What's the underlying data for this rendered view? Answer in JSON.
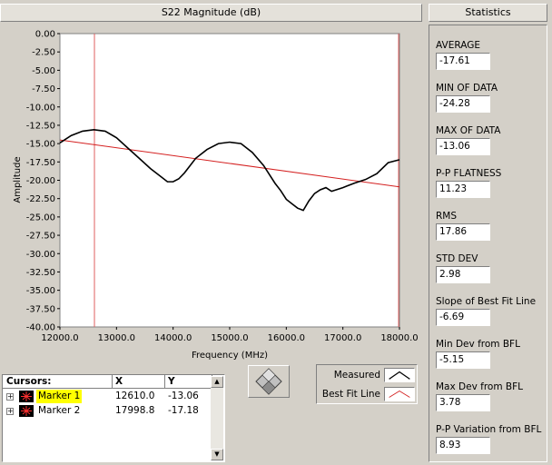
{
  "graph": {
    "title": "S22 Magnitude (dB)"
  },
  "stats": {
    "title": "Statistics",
    "items": [
      {
        "label": "AVERAGE",
        "value": "-17.61"
      },
      {
        "label": "MIN OF DATA",
        "value": "-24.28"
      },
      {
        "label": "MAX OF DATA",
        "value": "-13.06"
      },
      {
        "label": "P-P FLATNESS",
        "value": "11.23"
      },
      {
        "label": "RMS",
        "value": "17.86"
      },
      {
        "label": "STD DEV",
        "value": "2.98"
      },
      {
        "label": "Slope of Best Fit Line",
        "value": "-6.69"
      },
      {
        "label": "Min Dev from BFL",
        "value": "-5.15"
      },
      {
        "label": "Max Dev from BFL",
        "value": "3.78"
      },
      {
        "label": "P-P Variation from BFL",
        "value": "8.93"
      }
    ]
  },
  "cursors": {
    "header": "Cursors:",
    "col_x": "X",
    "col_y": "Y",
    "rows": [
      {
        "name": "Marker 1",
        "x": "12610.0",
        "y": "-13.06"
      },
      {
        "name": "Marker 2",
        "x": "17998.8",
        "y": "-17.18"
      }
    ]
  },
  "legend": {
    "measured": "Measured",
    "bestfit": "Best Fit Line"
  },
  "colors": {
    "measured": "#000000",
    "bestfit": "#d42020",
    "cursor_line": "#e06060",
    "highlight": "#ffff00"
  },
  "chart_data": {
    "type": "line",
    "title": "S22 Magnitude (dB)",
    "xlabel": "Frequency (MHz)",
    "ylabel": "Amplitude",
    "xlim": [
      12000,
      18000
    ],
    "ylim": [
      -40,
      0
    ],
    "x_ticks": [
      "12000.0",
      "13000.0",
      "14000.0",
      "15000.0",
      "16000.0",
      "17000.0",
      "18000.0"
    ],
    "y_ticks": [
      "0.00",
      "-2.50",
      "-5.00",
      "-7.50",
      "-10.00",
      "-12.50",
      "-15.00",
      "-17.50",
      "-20.00",
      "-22.50",
      "-25.00",
      "-27.50",
      "-30.00",
      "-32.50",
      "-35.00",
      "-37.50",
      "-40.00"
    ],
    "grid": false,
    "series": [
      {
        "name": "Measured",
        "x": [
          12000,
          12200,
          12400,
          12600,
          12800,
          13000,
          13200,
          13400,
          13600,
          13800,
          13900,
          14000,
          14100,
          14200,
          14300,
          14400,
          14600,
          14800,
          15000,
          15200,
          15400,
          15600,
          15800,
          15900,
          16000,
          16100,
          16200,
          16300,
          16400,
          16500,
          16600,
          16700,
          16800,
          17000,
          17200,
          17400,
          17600,
          17800,
          18000
        ],
        "y": [
          -14.9,
          -13.9,
          -13.3,
          -13.1,
          -13.3,
          -14.2,
          -15.6,
          -17.0,
          -18.4,
          -19.6,
          -20.2,
          -20.2,
          -19.8,
          -19.0,
          -18.0,
          -17.0,
          -15.8,
          -15.0,
          -14.8,
          -15.0,
          -16.2,
          -18.0,
          -20.4,
          -21.4,
          -22.6,
          -23.2,
          -23.8,
          -24.1,
          -22.8,
          -21.8,
          -21.3,
          -21.0,
          -21.5,
          -21.0,
          -20.4,
          -19.9,
          -19.1,
          -17.6,
          -17.2
        ]
      },
      {
        "name": "Best Fit Line",
        "x": [
          12000,
          18000
        ],
        "y": [
          -14.5,
          -20.9
        ]
      }
    ],
    "cursors": [
      {
        "name": "Marker 1",
        "x": 12610.0,
        "y": -13.06
      },
      {
        "name": "Marker 2",
        "x": 17998.8,
        "y": -17.18
      }
    ]
  }
}
